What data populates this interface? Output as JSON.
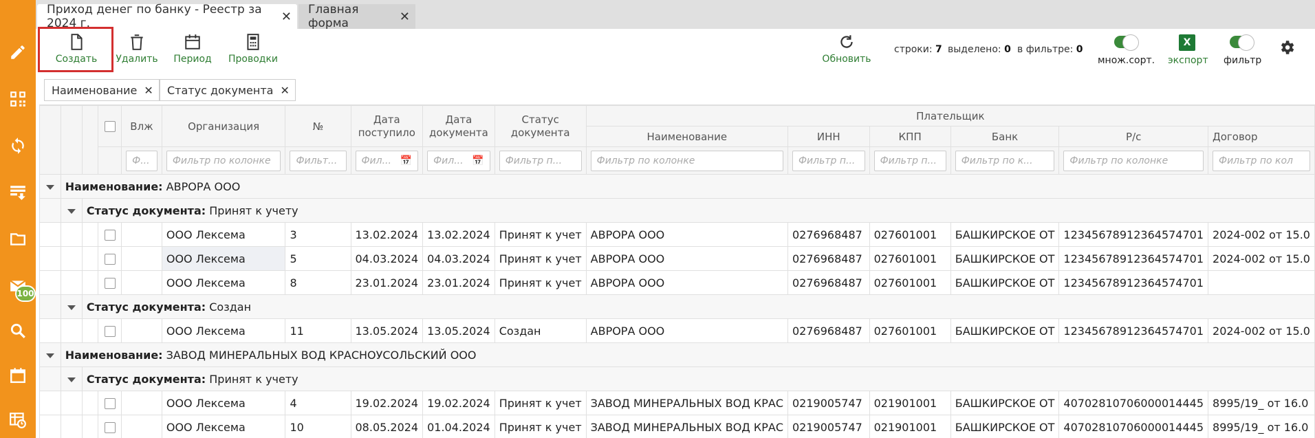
{
  "tabs": [
    {
      "label": "Приход денег по банку - Реестр за 2024 г.",
      "active": true
    },
    {
      "label": "Главная форма",
      "active": false
    }
  ],
  "toolbar": {
    "create": "Создать",
    "delete": "Удалить",
    "period": "Период",
    "postings": "Проводки",
    "refresh": "Обновить",
    "rows_label": "строки:",
    "rows_value": "7",
    "selected_label": "выделено:",
    "selected_value": "0",
    "filtered_label": "в фильтре:",
    "filtered_value": "0",
    "multisort": "множ.сорт.",
    "export": "экспорт",
    "filter": "фильтр"
  },
  "group_chips": [
    {
      "label": "Наименование"
    },
    {
      "label": "Статус документа"
    }
  ],
  "sidebar": {
    "icons": [
      "pencil-icon",
      "qr-icon",
      "sync-icon",
      "list-download-icon",
      "folder-icon",
      "mail-icon",
      "search-icon",
      "calendar-icon",
      "table-clock-icon"
    ],
    "badge": "100"
  },
  "grid": {
    "headers": {
      "vlzh": "Влж",
      "org": "Организация",
      "num": "№",
      "date_received": "Дата поступило",
      "date_doc": "Дата документа",
      "status": "Статус документа",
      "payer_group": "Плательщик",
      "name": "Наименование",
      "inn": "ИНН",
      "kpp": "КПП",
      "bank": "Банк",
      "account": "Р/с",
      "contract": "Договор"
    },
    "filters": {
      "vlzh": "Ф...",
      "org": "Фильтр по колонке",
      "num": "Фильт...",
      "date_received": "Фил...",
      "date_doc": "Фил...",
      "status": "Фильтр п...",
      "name": "Фильтр по колонке",
      "inn": "Фильтр п...",
      "kpp": "Фильтр п...",
      "bank": "Фильтр по к...",
      "account": "Фильтр по колонке",
      "contract": "Фильтр по кол"
    },
    "group_name_label": "Наименование:",
    "group_status_label": "Статус документа:",
    "groups": [
      {
        "name": "АВРОРА ООО",
        "statuses": [
          {
            "status": "Принят к учету",
            "rows": [
              {
                "org": "ООО Лексема",
                "num": "3",
                "date_received": "13.02.2024",
                "date_doc": "13.02.2024",
                "status": "Принят к учет",
                "name": "АВРОРА ООО",
                "inn": "0276968487",
                "kpp": "027601001",
                "bank": "БАШКИРСКОЕ ОТ",
                "account": "12345678912364574701",
                "contract": "2024-002 от 15.0"
              },
              {
                "org": "ООО Лексема",
                "num": "5",
                "date_received": "04.03.2024",
                "date_doc": "04.03.2024",
                "status": "Принят к учет",
                "name": "АВРОРА ООО",
                "inn": "0276968487",
                "kpp": "027601001",
                "bank": "БАШКИРСКОЕ ОТ",
                "account": "12345678912364574701",
                "contract": "2024-002 от 15.0"
              },
              {
                "org": "ООО Лексема",
                "num": "8",
                "date_received": "23.01.2024",
                "date_doc": "23.01.2024",
                "status": "Принят к учет",
                "name": "АВРОРА ООО",
                "inn": "0276968487",
                "kpp": "027601001",
                "bank": "БАШКИРСКОЕ ОТ",
                "account": "12345678912364574701",
                "contract": ""
              }
            ]
          },
          {
            "status": "Создан",
            "rows": [
              {
                "org": "ООО Лексема",
                "num": "11",
                "date_received": "13.05.2024",
                "date_doc": "13.05.2024",
                "status": "Создан",
                "name": "АВРОРА ООО",
                "inn": "0276968487",
                "kpp": "027601001",
                "bank": "БАШКИРСКОЕ ОТ",
                "account": "12345678912364574701",
                "contract": "2024-002 от 15.0"
              }
            ]
          }
        ]
      },
      {
        "name": "ЗАВОД МИНЕРАЛЬНЫХ ВОД КРАСНОУСОЛЬСКИЙ ООО",
        "statuses": [
          {
            "status": "Принят к учету",
            "rows": [
              {
                "org": "ООО Лексема",
                "num": "4",
                "date_received": "19.02.2024",
                "date_doc": "19.02.2024",
                "status": "Принят к учет",
                "name": "ЗАВОД МИНЕРАЛЬНЫХ ВОД КРАС",
                "inn": "0219005747",
                "kpp": "021901001",
                "bank": "БАШКИРСКОЕ ОТ",
                "account": "40702810706000014445",
                "contract": "8995/19_ от 16.0"
              },
              {
                "org": "ООО Лексема",
                "num": "10",
                "date_received": "08.05.2024",
                "date_doc": "01.04.2024",
                "status": "Принят к учет",
                "name": "ЗАВОД МИНЕРАЛЬНЫХ ВОД КРАС",
                "inn": "0219005747",
                "kpp": "021901001",
                "bank": "БАШКИРСКОЕ ОТ",
                "account": "40702810706000014445",
                "contract": "8995/19_ от 16.0"
              }
            ]
          }
        ]
      }
    ]
  }
}
